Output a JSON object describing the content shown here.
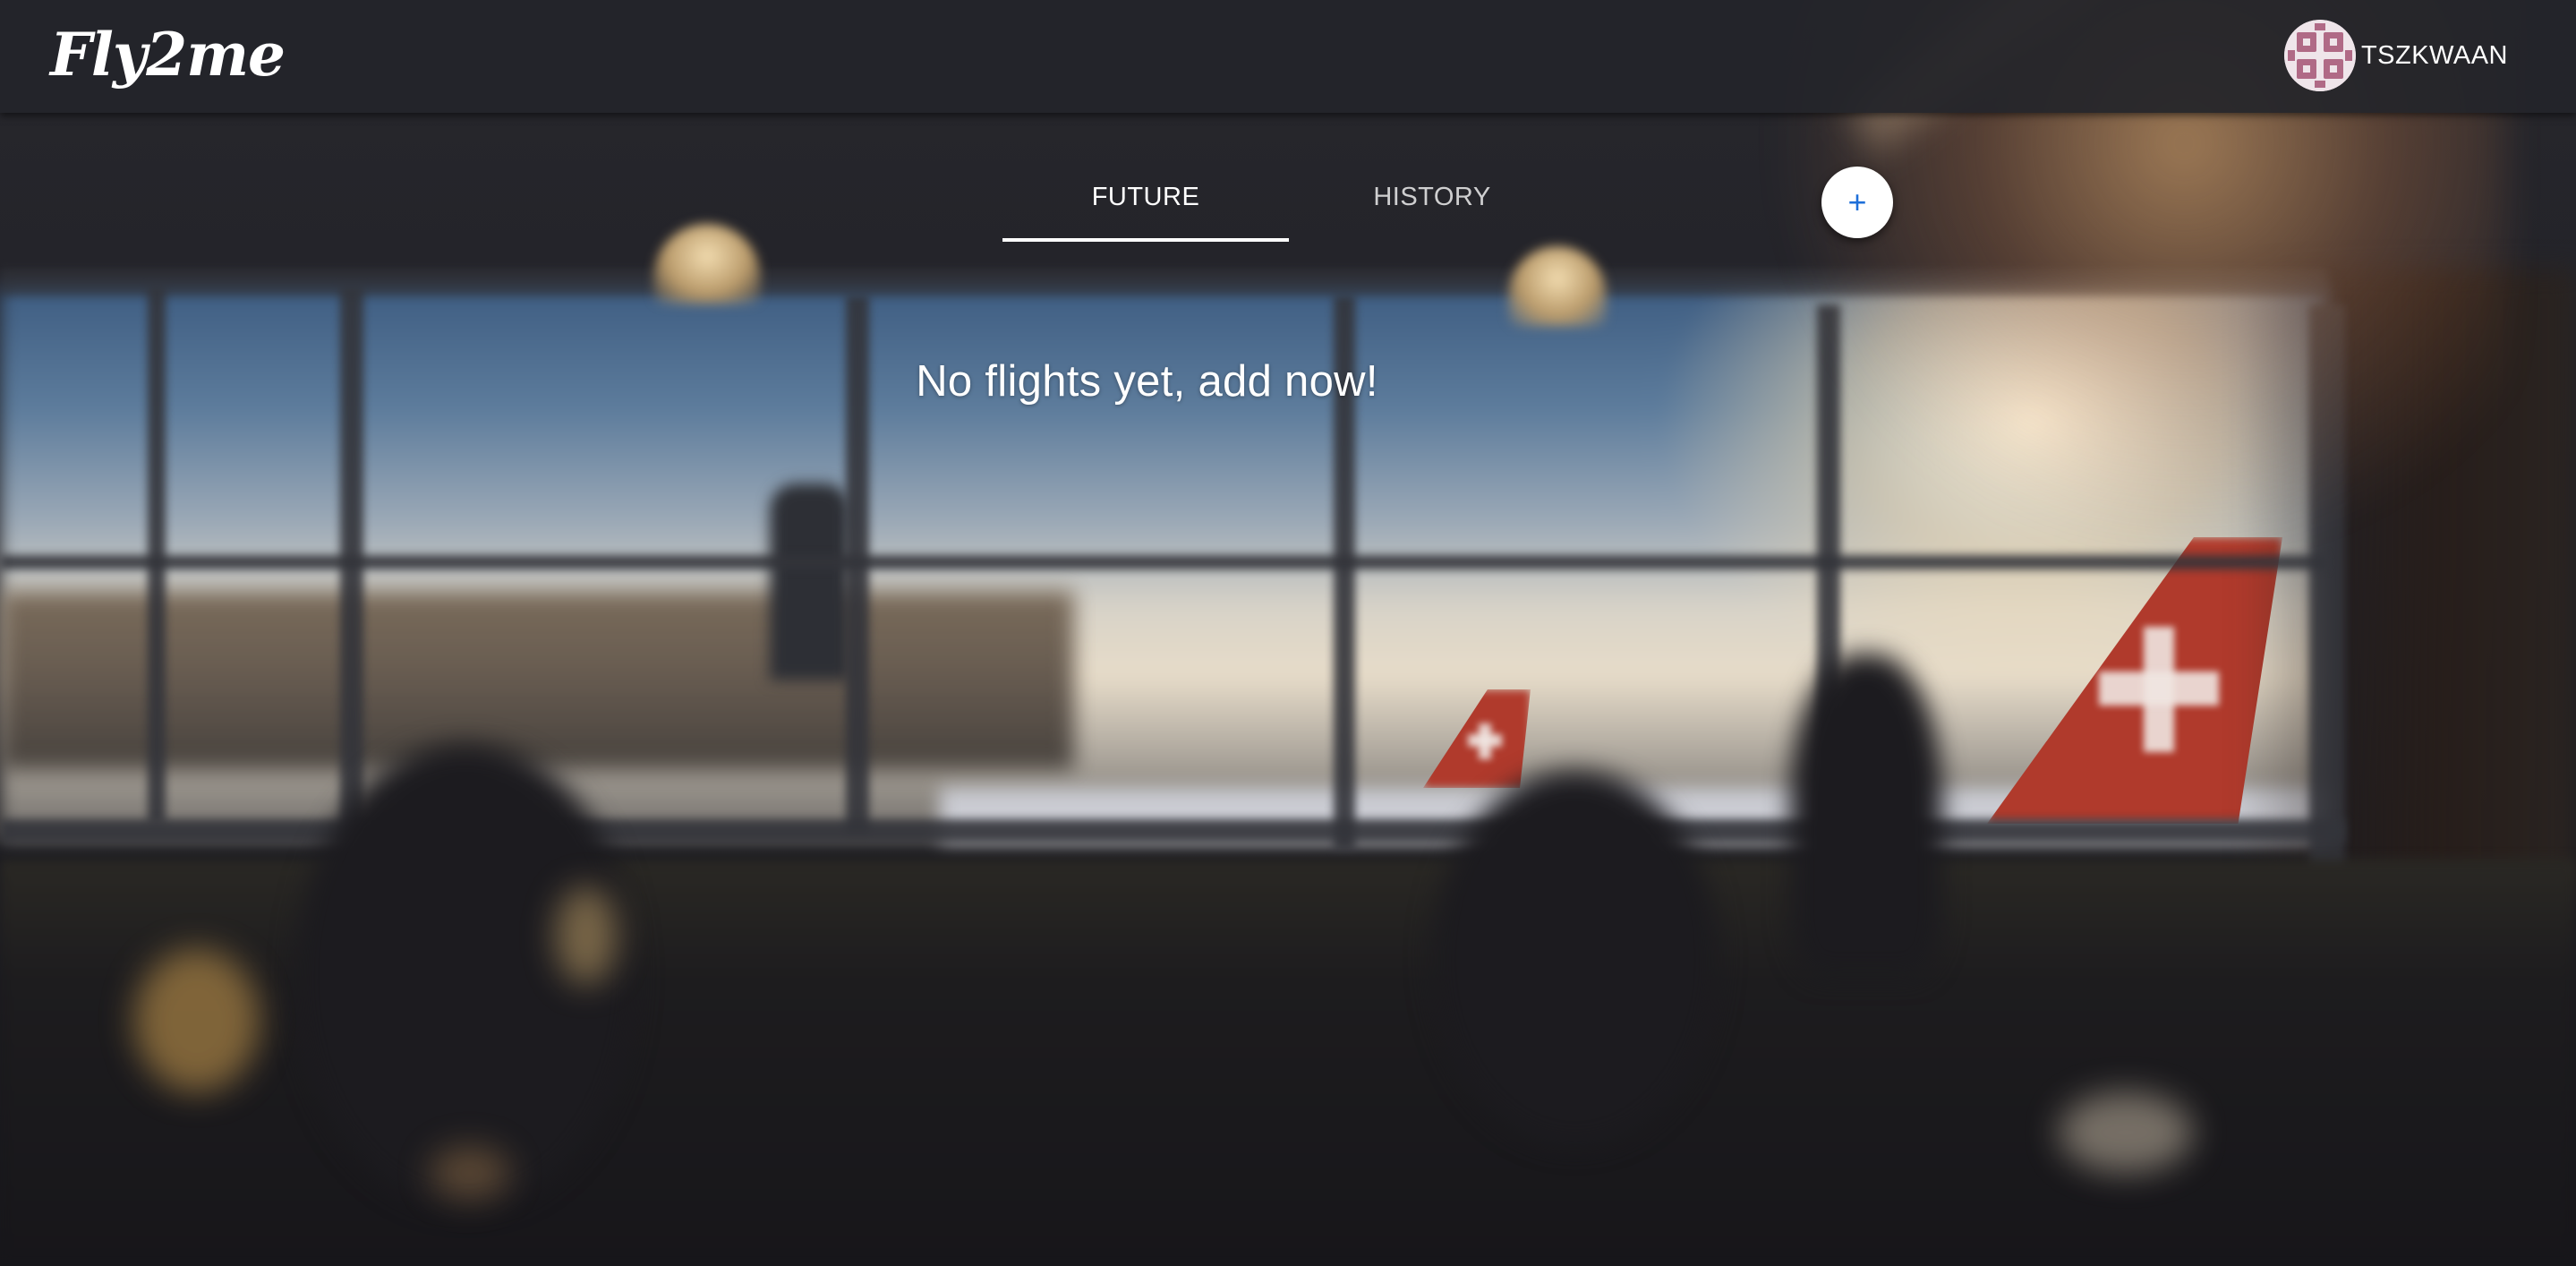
{
  "app": {
    "logo_text": "Fly2me"
  },
  "user": {
    "username": "TSZKWAAN",
    "avatar_icon": "user-avatar-icon"
  },
  "tabs": [
    {
      "label": "FUTURE",
      "active": true
    },
    {
      "label": "HISTORY",
      "active": false
    }
  ],
  "add_button": {
    "icon": "plus-icon",
    "label": "+"
  },
  "main": {
    "empty_message": "No flights yet, add now!"
  },
  "colors": {
    "topbar_bg": "#24252a",
    "accent": "#1e6fd9",
    "text": "#ffffff"
  }
}
